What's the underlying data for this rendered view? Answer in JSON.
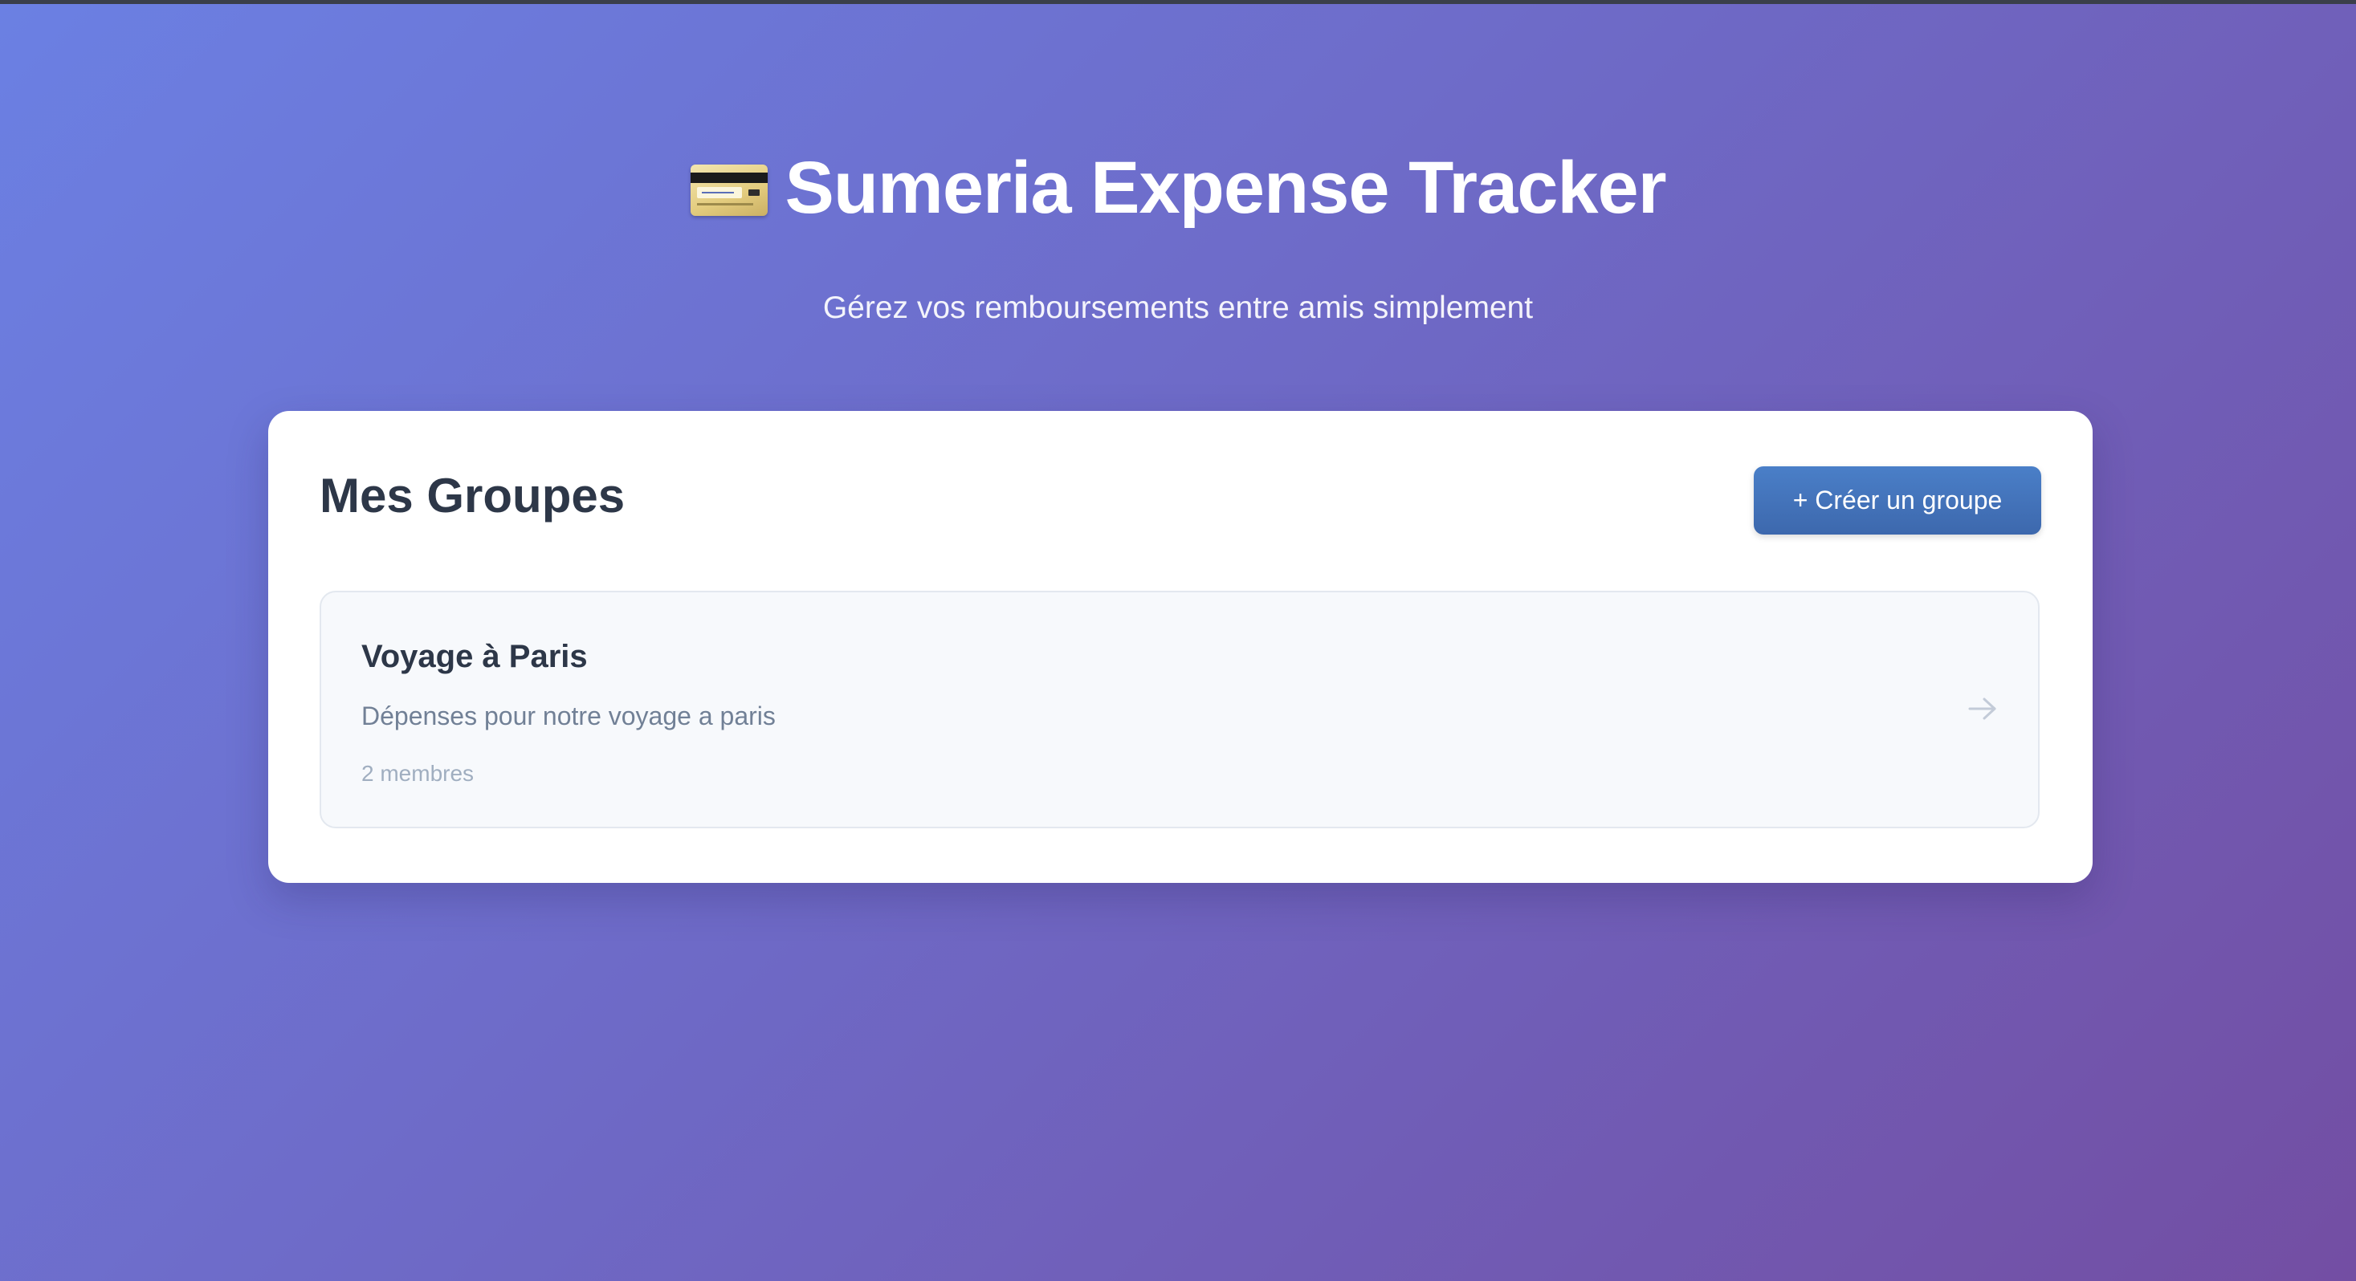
{
  "app": {
    "icon": "credit-card-icon",
    "title": "Sumeria Expense Tracker",
    "subtitle": "Gérez vos remboursements entre amis simplement"
  },
  "groups_panel": {
    "title": "Mes Groupes",
    "create_button_label": "+ Créer un groupe",
    "groups": [
      {
        "name": "Voyage à Paris",
        "description": "Dépenses pour notre voyage a paris",
        "members": "2 membres",
        "icon": "arrow-right-icon"
      }
    ]
  },
  "colors": {
    "background_gradient": [
      "#6b80e3",
      "#734ea3"
    ],
    "primary_button": "#4a7fc8",
    "heading_text": "#2d3748",
    "muted_text": "#718096"
  }
}
